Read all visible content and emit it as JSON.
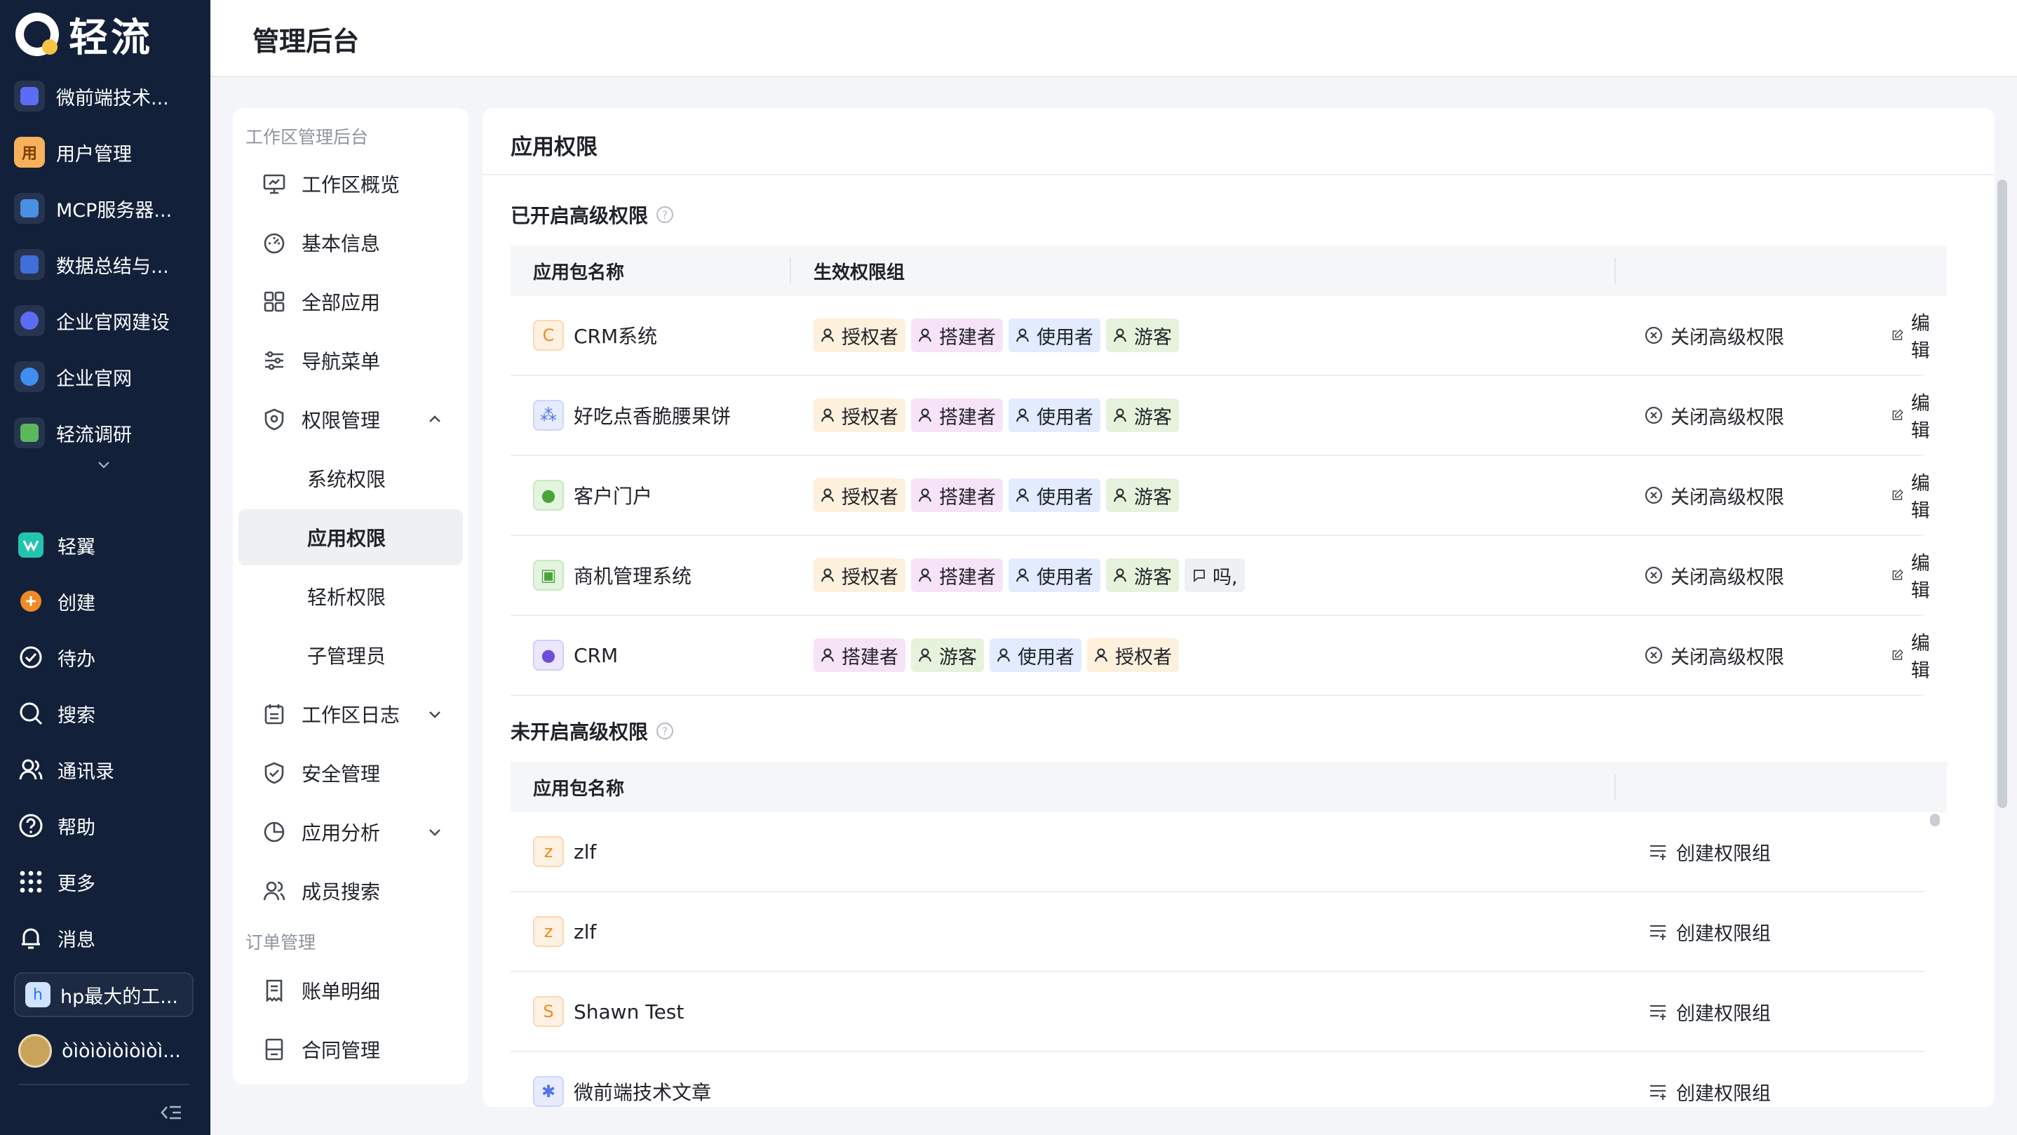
{
  "brand": {
    "name": "轻流"
  },
  "nav": {
    "apps": [
      {
        "label": "微前端技术...",
        "icon": "puzzle-icon",
        "color": "#5b6cf5"
      },
      {
        "label": "用户管理",
        "icon": "user-mgmt-icon",
        "glyph": "用",
        "color": "#f5a623"
      },
      {
        "label": "MCP服务器...",
        "icon": "server-icon",
        "color": "#4a90e2"
      },
      {
        "label": "数据总结与...",
        "icon": "data-icon",
        "color": "#3f6fd8"
      },
      {
        "label": "企业官网建设",
        "icon": "globe-icon",
        "color": "#5b6cf5"
      },
      {
        "label": "企业官网",
        "icon": "globe-icon",
        "color": "#3f8ef0"
      },
      {
        "label": "轻流调研",
        "icon": "survey-icon",
        "color": "#5cb85c"
      }
    ],
    "tools": [
      {
        "label": "轻翼",
        "icon": "qingyi-icon"
      },
      {
        "label": "创建",
        "icon": "plus-circle-icon"
      },
      {
        "label": "待办",
        "icon": "check-circle-icon"
      },
      {
        "label": "搜索",
        "icon": "search-icon"
      },
      {
        "label": "通讯录",
        "icon": "contacts-icon"
      },
      {
        "label": "帮助",
        "icon": "help-icon"
      },
      {
        "label": "更多",
        "icon": "grid-icon"
      },
      {
        "label": "消息",
        "icon": "bell-icon"
      }
    ],
    "workspace": {
      "label": "hp最大的工...",
      "glyph": "h"
    },
    "user": {
      "label": "òìòìòìòìòìòì..."
    }
  },
  "header": {
    "title": "管理后台"
  },
  "menu": {
    "group1": "工作区管理后台",
    "items": [
      {
        "label": "工作区概览",
        "icon": "monitor-icon"
      },
      {
        "label": "基本信息",
        "icon": "dashboard-icon"
      },
      {
        "label": "全部应用",
        "icon": "apps-icon"
      },
      {
        "label": "导航菜单",
        "icon": "sliders-icon"
      },
      {
        "label": "权限管理",
        "icon": "shield-icon"
      }
    ],
    "subs": [
      "系统权限",
      "应用权限",
      "轻析权限",
      "子管理员"
    ],
    "items2": [
      {
        "label": "工作区日志",
        "icon": "calendar-icon"
      },
      {
        "label": "安全管理",
        "icon": "shield-check-icon"
      },
      {
        "label": "应用分析",
        "icon": "pie-icon"
      },
      {
        "label": "成员搜索",
        "icon": "members-icon"
      }
    ],
    "group2": "订单管理",
    "items3": [
      {
        "label": "账单明细",
        "icon": "bill-icon"
      },
      {
        "label": "合同管理",
        "icon": "contract-icon"
      }
    ]
  },
  "main": {
    "title": "应用权限",
    "enabled": {
      "title": "已开启高级权限",
      "col_app": "应用包名称",
      "col_group": "生效权限组",
      "rows": [
        {
          "name": "CRM系统",
          "glyph": "C",
          "tags": [
            [
              "授权者",
              "auth"
            ],
            [
              "搭建者",
              "build"
            ],
            [
              "使用者",
              "user"
            ],
            [
              "游客",
              "guest"
            ]
          ]
        },
        {
          "name": "好吃点香脆腰果饼",
          "glyph": "⁂",
          "tags": [
            [
              "授权者",
              "auth"
            ],
            [
              "搭建者",
              "build"
            ],
            [
              "使用者",
              "user"
            ],
            [
              "游客",
              "guest"
            ]
          ]
        },
        {
          "name": "客户门户",
          "glyph": "●",
          "tags": [
            [
              "授权者",
              "auth"
            ],
            [
              "搭建者",
              "build"
            ],
            [
              "使用者",
              "user"
            ],
            [
              "游客",
              "guest"
            ]
          ]
        },
        {
          "name": "商机管理系统",
          "glyph": "▣",
          "tags": [
            [
              "授权者",
              "auth"
            ],
            [
              "搭建者",
              "build"
            ],
            [
              "使用者",
              "user"
            ],
            [
              "游客",
              "guest"
            ],
            [
              "吗,",
              "other"
            ]
          ]
        },
        {
          "name": "CRM",
          "glyph": "●",
          "tags": [
            [
              "搭建者",
              "build"
            ],
            [
              "游客",
              "guest"
            ],
            [
              "使用者",
              "user"
            ],
            [
              "授权者",
              "auth"
            ]
          ]
        }
      ],
      "close_label": "关闭高级权限",
      "edit_label": "编辑"
    },
    "disabled": {
      "title": "未开启高级权限",
      "col_app": "应用包名称",
      "rows": [
        {
          "name": "zlf",
          "glyph": "z"
        },
        {
          "name": "zlf",
          "glyph": "z"
        },
        {
          "name": "Shawn Test",
          "glyph": "S"
        },
        {
          "name": "微前端技术文章",
          "glyph": "✱"
        }
      ],
      "create_label": "创建权限组"
    }
  }
}
